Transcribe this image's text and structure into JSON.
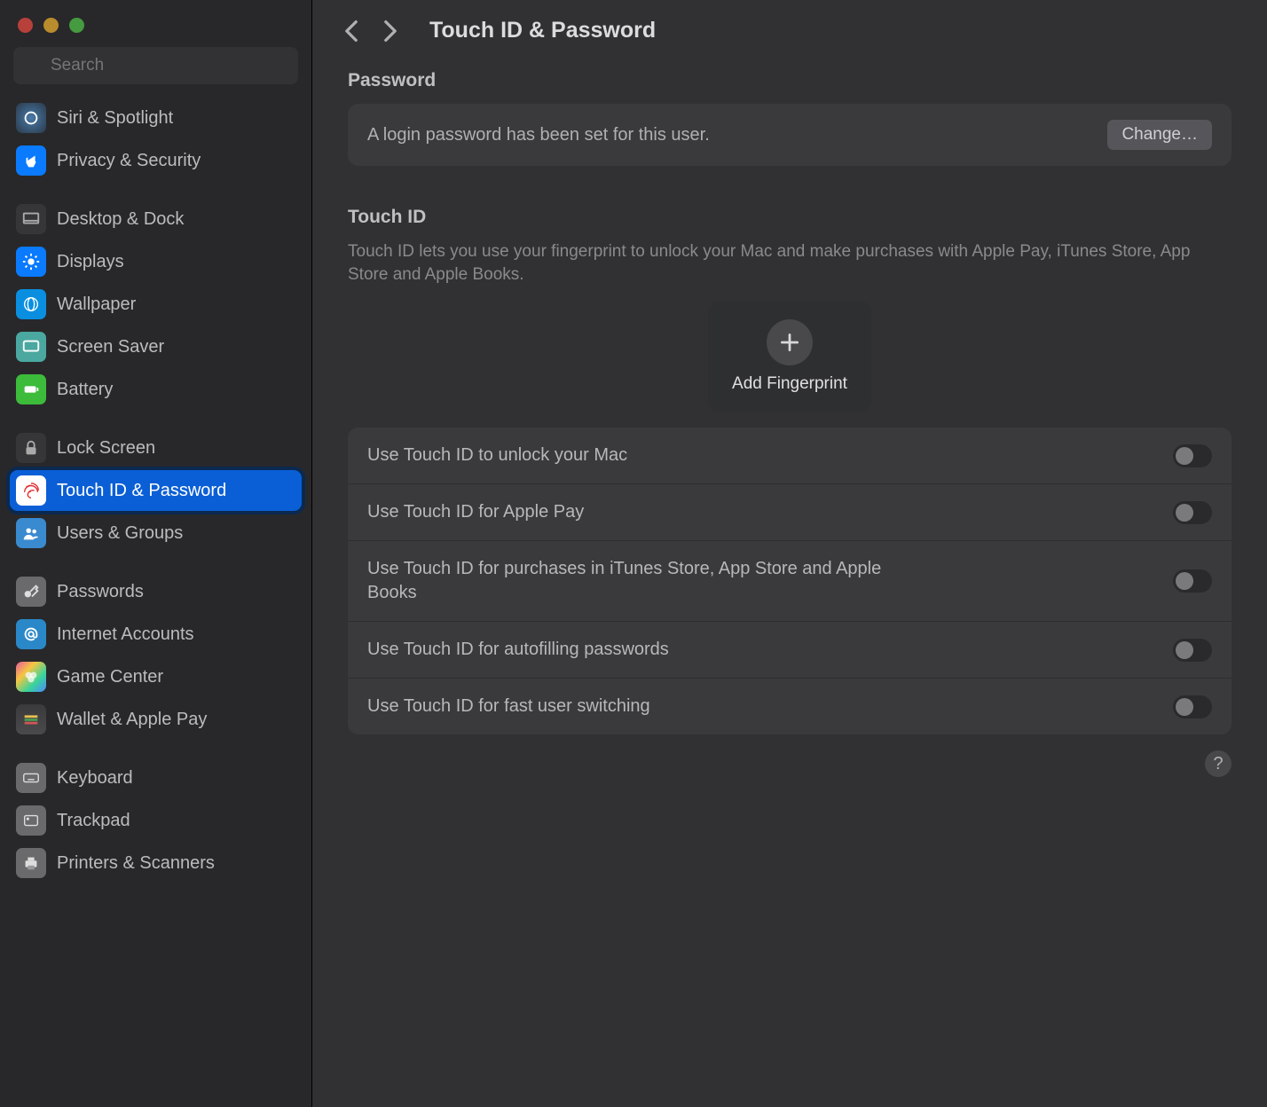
{
  "search": {
    "placeholder": "Search"
  },
  "sidebar": {
    "items": [
      {
        "label": "Siri & Spotlight"
      },
      {
        "label": "Privacy & Security"
      },
      {
        "label": "Desktop & Dock"
      },
      {
        "label": "Displays"
      },
      {
        "label": "Wallpaper"
      },
      {
        "label": "Screen Saver"
      },
      {
        "label": "Battery"
      },
      {
        "label": "Lock Screen"
      },
      {
        "label": "Touch ID & Password"
      },
      {
        "label": "Users & Groups"
      },
      {
        "label": "Passwords"
      },
      {
        "label": "Internet Accounts"
      },
      {
        "label": "Game Center"
      },
      {
        "label": "Wallet & Apple Pay"
      },
      {
        "label": "Keyboard"
      },
      {
        "label": "Trackpad"
      },
      {
        "label": "Printers & Scanners"
      }
    ]
  },
  "header": {
    "title": "Touch ID & Password"
  },
  "password": {
    "section_label": "Password",
    "desc": "A login password has been set for this user.",
    "change_label": "Change…"
  },
  "touchid": {
    "section_label": "Touch ID",
    "desc": "Touch ID lets you use your fingerprint to unlock your Mac and make purchases with Apple Pay, iTunes Store, App Store and Apple Books.",
    "add_label": "Add Fingerprint",
    "toggles": [
      {
        "label": "Use Touch ID to unlock your Mac"
      },
      {
        "label": "Use Touch ID for Apple Pay"
      },
      {
        "label": "Use Touch ID for purchases in iTunes Store, App Store and Apple Books"
      },
      {
        "label": "Use Touch ID for autofilling passwords"
      },
      {
        "label": "Use Touch ID for fast user switching"
      }
    ]
  },
  "help": {
    "label": "?"
  }
}
